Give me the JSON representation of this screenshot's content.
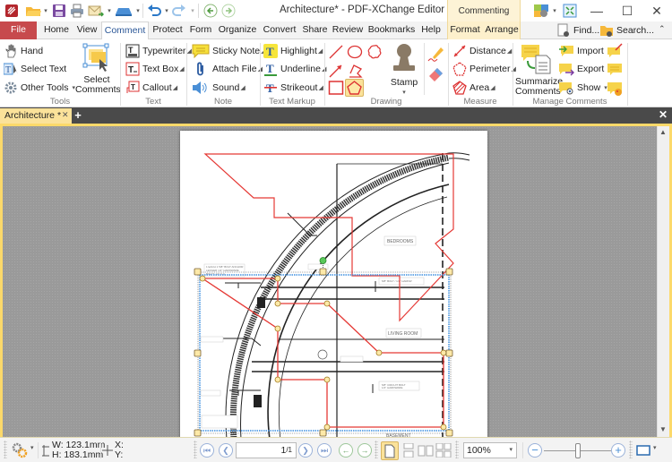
{
  "app": {
    "title": "Architecture* - PDF-XChange Editor",
    "context_header": "Commenting Tools"
  },
  "quick_access": {
    "icons": [
      "app-logo-icon",
      "open-folder-icon",
      "save-icon",
      "print-icon",
      "email-icon",
      "scan-icon",
      "undo-icon",
      "redo-icon",
      "back-icon",
      "forward-icon"
    ]
  },
  "window_controls": {
    "minimize": "—",
    "maximize": "☐",
    "close": "✕"
  },
  "menu": {
    "tabs": [
      "File",
      "Home",
      "View",
      "Comment",
      "Protect",
      "Form",
      "Organize",
      "Convert",
      "Share",
      "Review",
      "Bookmarks",
      "Help",
      "Format",
      "Arrange"
    ],
    "active": "Comment",
    "find_label": "Find...",
    "search_label": "Search..."
  },
  "ribbon": {
    "groups": {
      "tools": {
        "label": "Tools",
        "hand": "Hand",
        "select_text": "Select Text",
        "other_tools": "Other Tools",
        "select_comments_line1": "Select",
        "select_comments_line2": "Comments"
      },
      "text": {
        "label": "Text",
        "typewriter": "Typewriter",
        "text_box": "Text Box",
        "callout": "Callout"
      },
      "note": {
        "label": "Note",
        "sticky_note": "Sticky Note",
        "attach_file": "Attach File",
        "sound": "Sound"
      },
      "text_markup": {
        "label": "Text Markup",
        "highlight": "Highlight",
        "underline": "Underline",
        "strikeout": "Strikeout"
      },
      "drawing": {
        "label": "Drawing",
        "stamp": "Stamp"
      },
      "measure": {
        "label": "Measure",
        "distance": "Distance",
        "perimeter": "Perimeter",
        "area": "Area"
      },
      "manage_comments": {
        "label": "Manage Comments",
        "summarize_line1": "Summarize",
        "summarize_line2": "Comments",
        "import": "Import",
        "export": "Export",
        "show": "Show"
      }
    }
  },
  "document_tabs": [
    {
      "label": "Architecture *",
      "active": true
    }
  ],
  "drawing_labels": {
    "bedrooms": "BEDROOMS",
    "living_room": "LIVING ROOM",
    "basement": "BASEMENT"
  },
  "status": {
    "width": "W: 123.1mm",
    "height": "H: 183.1mm",
    "x": "X:",
    "y": "Y:",
    "page_value": "1",
    "page_total": "/1",
    "zoom": "100%",
    "zoom_slider": 0.5
  },
  "colors": {
    "file_tab": "#c74a4d",
    "context_tab": "#fdf0cc",
    "doc_tab": "#fbe29a",
    "annotation_red": "#e53935",
    "selection_blue": "#3d8fe0"
  }
}
